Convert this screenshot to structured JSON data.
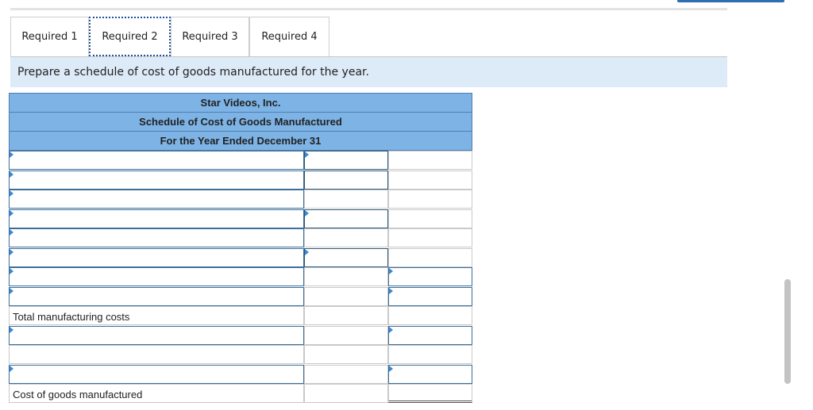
{
  "tabs": [
    "Required 1",
    "Required 2",
    "Required 3",
    "Required 4"
  ],
  "instruction": "Prepare a schedule of cost of goods manufactured for the year.",
  "schedule": {
    "company": "Star Videos, Inc.",
    "title": "Schedule of Cost of Goods Manufactured",
    "period": "For the Year Ended December 31",
    "total_manufacturing_label": "Total manufacturing costs",
    "cogm_label": "Cost of goods manufactured"
  },
  "colors": {
    "header_bg": "#7eb3e6",
    "instruction_bg": "#ddeaf7",
    "input_border": "#3b6e99",
    "marker": "#3f86d0"
  }
}
